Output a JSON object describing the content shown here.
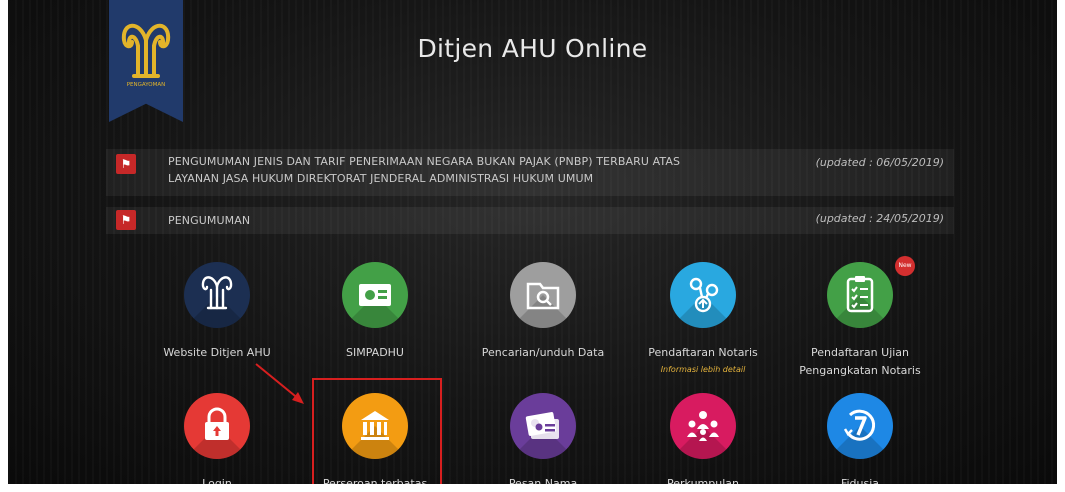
{
  "header": {
    "title": "Ditjen AHU Online",
    "logo_text": "PENGAYOMAN"
  },
  "announcements": [
    {
      "text": "PENGUMUMAN JENIS DAN TARIF PENERIMAAN NEGARA BUKAN PAJAK (PNBP) TERBARU ATAS LAYANAN JASA HUKUM DIREKTORAT JENDERAL ADMINISTRASI HUKUM UMUM",
      "updated": "(updated : 06/05/2019)",
      "icon": "megaphone-icon"
    },
    {
      "text": "PENGUMUMAN",
      "updated": "(updated : 24/05/2019)",
      "icon": "megaphone-icon"
    }
  ],
  "menu": {
    "row1": [
      {
        "label": "Website Ditjen AHU",
        "icon": "pengayoman-logo-icon",
        "color": "#1c2f52"
      },
      {
        "label": "SIMPADHU",
        "icon": "id-card-icon",
        "color": "#43a047"
      },
      {
        "label": "Pencarian/unduh Data",
        "icon": "folder-search-icon",
        "color": "#9e9e9e"
      },
      {
        "label": "Pendaftaran Notaris",
        "sub": "Informasi lebih detail",
        "icon": "network-icon",
        "color": "#29a8e0"
      },
      {
        "label": "Pendaftaran Ujian Pengangkatan Notaris",
        "icon": "clipboard-checklist-icon",
        "color": "#43a047",
        "badge": "New"
      }
    ],
    "row2": [
      {
        "label": "Login",
        "icon": "lock-icon",
        "color": "#e53935"
      },
      {
        "label": "Perseroan terbatas",
        "icon": "building-columns-icon",
        "color": "#f39c12"
      },
      {
        "label": "Pesan Nama",
        "icon": "id-badge-icon",
        "color": "#6a3d9a"
      },
      {
        "label": "Perkumpulan",
        "icon": "people-group-icon",
        "color": "#d81b60"
      },
      {
        "label": "Fidusia",
        "icon": "clock-7-icon",
        "color": "#1e88e5"
      }
    ]
  },
  "colors": {
    "background": "#141414",
    "banner": "#213a6b",
    "logo_gold": "#e2b42a",
    "highlight": "#d71f1f",
    "announcement_flag": "#c62828"
  }
}
